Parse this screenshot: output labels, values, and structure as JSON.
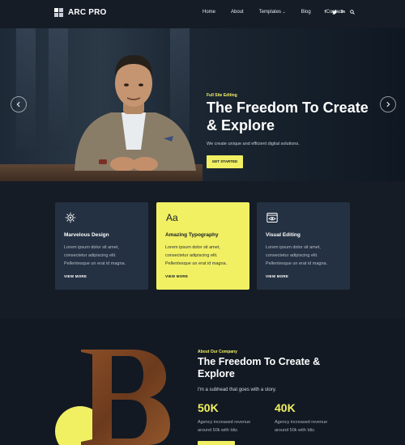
{
  "nav": {
    "brand": "ARC PRO",
    "menu": [
      "Home",
      "About",
      "Templates",
      "Blog",
      "Contact"
    ],
    "socials": [
      "f",
      "t",
      "in",
      "search"
    ]
  },
  "hero": {
    "kicker": "Full Site Editing",
    "title": "The Freedom To Create & Explore",
    "subtitle": "We create unique and efficient digital solutions.",
    "cta": "GET STARTED",
    "prev_icon": "chevron-left-icon",
    "next_icon": "chevron-right-icon"
  },
  "features": [
    {
      "icon": "gear-icon",
      "title": "Marvelous Design",
      "body": "Lorem ipsum dolor sit amet, consectetur adipiscing elit. Pellentesque un erat id magna.",
      "link": "VIEW MORE"
    },
    {
      "icon": "Aa",
      "title": "Amazing Typography",
      "body": "Lorem ipsum dolor sit amet, consectetur adipiscing elit. Pellentesque un erat id magna.",
      "link": "VIEW MORE"
    },
    {
      "icon": "browser-eye-icon",
      "title": "Visual Editing",
      "body": "Lorem ipsum dolor sit amet, consectetur adipiscing elit. Pellentesque un erat id magna.",
      "link": "VIEW MORE"
    }
  ],
  "about": {
    "kicker": "About Our Company",
    "title": "The Freedom To Create & Explore",
    "subtitle": "I'm a subhead that goes with a story.",
    "stats": [
      {
        "value": "50K",
        "label": "Agency increased revenue around 50k with Idiz."
      },
      {
        "value": "40K",
        "label": "Agency increased revenue around 50k with Idiz."
      }
    ]
  },
  "colors": {
    "accent": "#f1f063",
    "background": "#151c26",
    "card": "#243142"
  }
}
